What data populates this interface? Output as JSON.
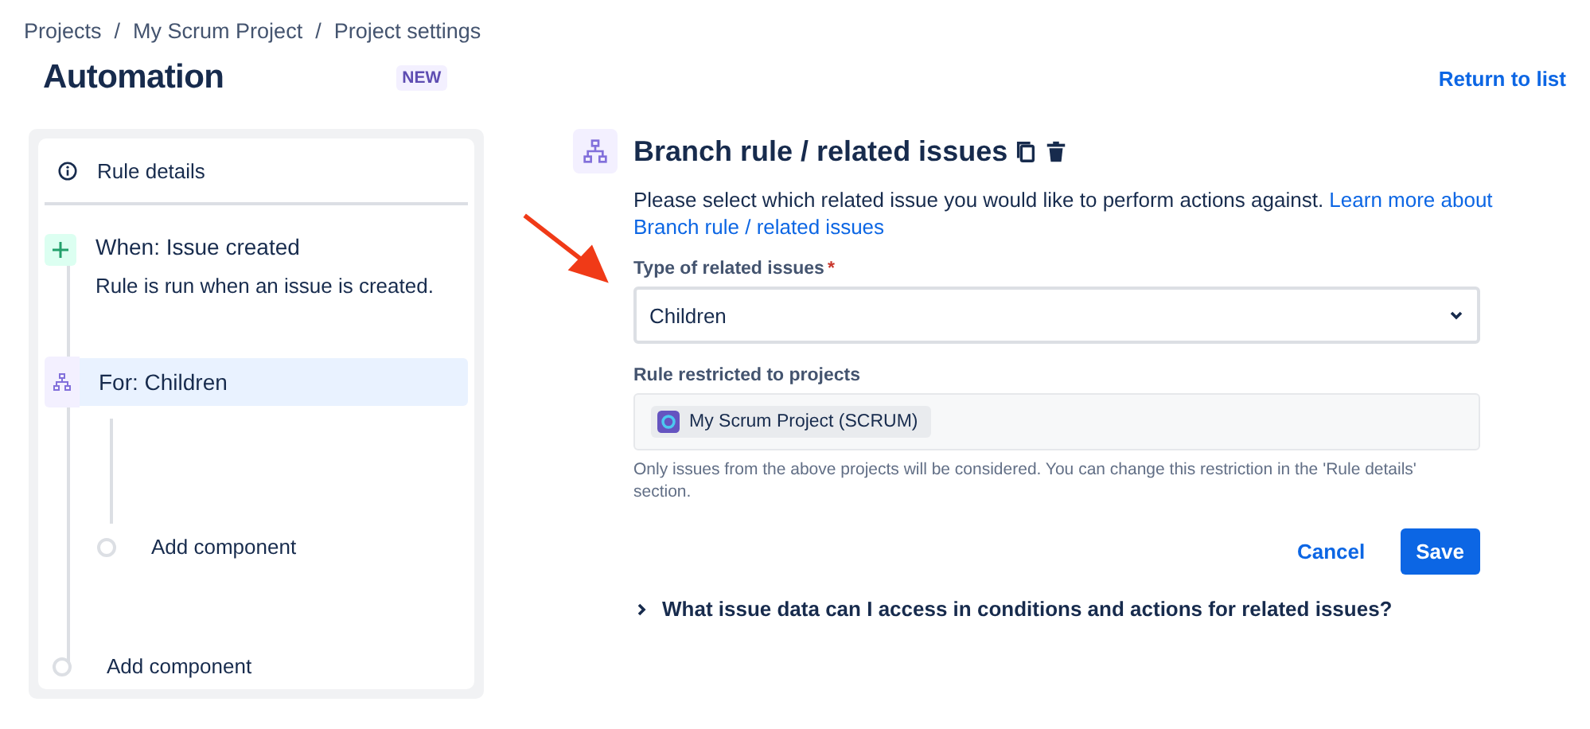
{
  "breadcrumbs": {
    "separator": "/",
    "items": [
      "Projects",
      "My Scrum Project",
      "Project settings"
    ]
  },
  "header": {
    "title": "Automation",
    "badge": "NEW",
    "return_link": "Return to list"
  },
  "rule_panel": {
    "details": "Rule details",
    "steps": [
      {
        "kind": "trigger",
        "title": "When: Issue created",
        "description": "Rule is run when an issue is created.",
        "selected": false
      },
      {
        "kind": "branch",
        "title": "For: Children",
        "selected": true,
        "children": [
          {
            "kind": "add",
            "title": "Add component",
            "selected": false
          }
        ]
      },
      {
        "kind": "add",
        "title": "Add component",
        "selected": false
      }
    ]
  },
  "editor": {
    "title": "Branch rule / related issues",
    "description": "Please select which related issue you would like to perform actions against.",
    "help_link": [
      "Learn more about",
      "Branch rule / related issues"
    ],
    "type_field": {
      "label": "Type of related issues",
      "required": true,
      "required_mark": "*",
      "value": "Children"
    },
    "projects_field": {
      "label": "Rule restricted to projects",
      "project": "My Scrum Project (SCRUM)",
      "hint": "Only issues from the above projects will be considered. You can change this restriction in the 'Rule details' section."
    },
    "buttons": {
      "cancel": "Cancel",
      "save": "Save"
    },
    "expander": {
      "label": "What issue data can I access in conditions and actions for related issues?",
      "expanded": false
    }
  }
}
